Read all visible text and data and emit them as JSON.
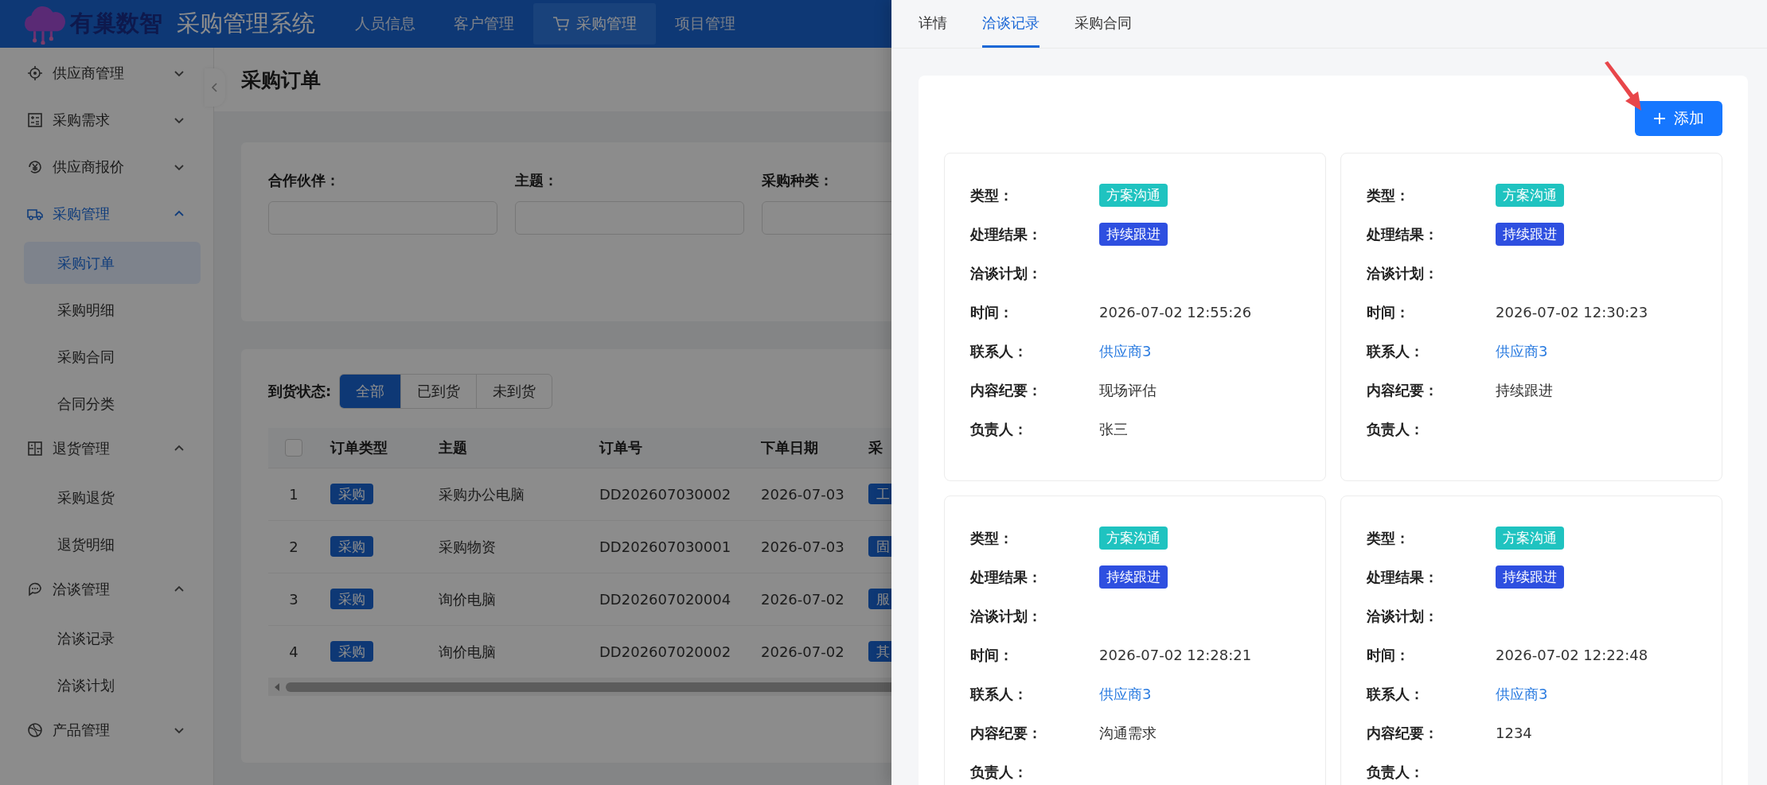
{
  "header": {
    "logo_text": "有巢数智",
    "system_title": "采购管理系统",
    "nav": [
      {
        "label": "人员信息",
        "selected": false
      },
      {
        "label": "客户管理",
        "selected": false
      },
      {
        "label": "采购管理",
        "selected": true
      },
      {
        "label": "项目管理",
        "selected": false
      }
    ]
  },
  "sidebar": {
    "items": [
      {
        "label": "供应商管理",
        "expanded": false,
        "selected": false
      },
      {
        "label": "采购需求",
        "expanded": false,
        "selected": false
      },
      {
        "label": "供应商报价",
        "expanded": false,
        "selected": false
      },
      {
        "label": "采购管理",
        "expanded": true,
        "selected": true,
        "children": [
          {
            "label": "采购订单",
            "selected": true
          },
          {
            "label": "采购明细",
            "selected": false
          },
          {
            "label": "采购合同",
            "selected": false
          },
          {
            "label": "合同分类",
            "selected": false
          }
        ]
      },
      {
        "label": "退货管理",
        "expanded": true,
        "selected": false,
        "children": [
          {
            "label": "采购退货",
            "selected": false
          },
          {
            "label": "退货明细",
            "selected": false
          }
        ]
      },
      {
        "label": "洽谈管理",
        "expanded": true,
        "selected": false,
        "children": [
          {
            "label": "洽谈记录",
            "selected": false
          },
          {
            "label": "洽谈计划",
            "selected": false
          }
        ]
      },
      {
        "label": "产品管理",
        "expanded": false,
        "selected": false
      }
    ]
  },
  "page": {
    "title": "采购订单",
    "filters": [
      {
        "label": "合作伙伴："
      },
      {
        "label": "主题："
      },
      {
        "label": "采购种类："
      }
    ],
    "arrival_status": {
      "label": "到货状态:",
      "options": [
        {
          "label": "全部",
          "selected": true
        },
        {
          "label": "已到货",
          "selected": false
        },
        {
          "label": "未到货",
          "selected": false
        }
      ]
    },
    "table": {
      "select_all": {
        "checked": false
      },
      "columns": [
        "订单类型",
        "主题",
        "订单号",
        "下单日期",
        "采"
      ],
      "rows": [
        {
          "no": "1",
          "type": "采购",
          "subject": "采购办公电脑",
          "order_no": "DD202607030002",
          "date": "2026-07-03",
          "column_5": "工"
        },
        {
          "no": "2",
          "type": "采购",
          "subject": "采购物资",
          "order_no": "DD202607030001",
          "date": "2026-07-03",
          "column_5": "固"
        },
        {
          "no": "3",
          "type": "采购",
          "subject": "询价电脑",
          "order_no": "DD202607020004",
          "date": "2026-07-02",
          "column_5": "服"
        },
        {
          "no": "4",
          "type": "采购",
          "subject": "询价电脑",
          "order_no": "DD202607020002",
          "date": "2026-07-02",
          "column_5": "其"
        }
      ]
    }
  },
  "drawer": {
    "tabs": [
      {
        "label": "详情",
        "selected": false
      },
      {
        "label": "洽谈记录",
        "selected": true
      },
      {
        "label": "采购合同",
        "selected": false
      }
    ],
    "add_button": "添加",
    "records": [
      {
        "fields": [
          {
            "label": "类型：",
            "kind": "type-tag",
            "value": "方案沟通"
          },
          {
            "label": "处理结果：",
            "kind": "result-tag",
            "value": "持续跟进"
          },
          {
            "label": "洽谈计划："
          },
          {
            "label": "时间：",
            "kind": "text",
            "value": "2026-07-02 12:55:26"
          },
          {
            "label": "联系人：",
            "kind": "link",
            "value": "供应商3"
          },
          {
            "label": "内容纪要：",
            "kind": "text",
            "value": "现场评估"
          },
          {
            "label": "负责人：",
            "kind": "text",
            "value": "张三"
          }
        ]
      },
      {
        "fields": [
          {
            "label": "类型：",
            "kind": "type-tag",
            "value": "方案沟通"
          },
          {
            "label": "处理结果：",
            "kind": "result-tag",
            "value": "持续跟进"
          },
          {
            "label": "洽谈计划："
          },
          {
            "label": "时间：",
            "kind": "text",
            "value": "2026-07-02 12:30:23"
          },
          {
            "label": "联系人：",
            "kind": "link",
            "value": "供应商3"
          },
          {
            "label": "内容纪要：",
            "kind": "text",
            "value": "持续跟进"
          },
          {
            "label": "负责人："
          }
        ]
      },
      {
        "fields": [
          {
            "label": "类型：",
            "kind": "type-tag",
            "value": "方案沟通"
          },
          {
            "label": "处理结果：",
            "kind": "result-tag",
            "value": "持续跟进"
          },
          {
            "label": "洽谈计划："
          },
          {
            "label": "时间：",
            "kind": "text",
            "value": "2026-07-02 12:28:21"
          },
          {
            "label": "联系人：",
            "kind": "link",
            "value": "供应商3"
          },
          {
            "label": "内容纪要：",
            "kind": "text",
            "value": "沟通需求"
          },
          {
            "label": "负责人："
          }
        ]
      },
      {
        "fields": [
          {
            "label": "类型：",
            "kind": "type-tag",
            "value": "方案沟通"
          },
          {
            "label": "处理结果：",
            "kind": "result-tag",
            "value": "持续跟进"
          },
          {
            "label": "洽谈计划："
          },
          {
            "label": "时间：",
            "kind": "text",
            "value": "2026-07-02 12:22:48"
          },
          {
            "label": "联系人：",
            "kind": "link",
            "value": "供应商3"
          },
          {
            "label": "内容纪要：",
            "kind": "text",
            "value": "1234"
          },
          {
            "label": "负责人："
          }
        ]
      }
    ]
  }
}
